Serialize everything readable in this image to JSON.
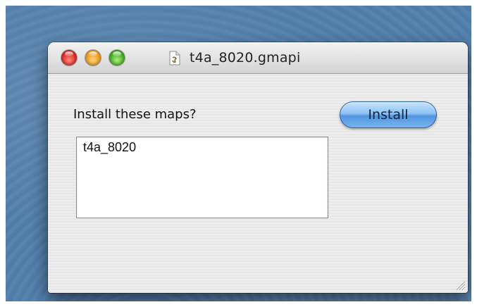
{
  "window": {
    "title": "t4a_8020.gmapi",
    "document_icon": "document-icon"
  },
  "dialog": {
    "prompt": "Install these maps?",
    "install_label": "Install",
    "maps": [
      "t4a_8020"
    ]
  },
  "colors": {
    "desktop": "#5680ad",
    "close": "#d6261c",
    "minimize": "#e8961b",
    "zoom": "#3ea81e",
    "install_button": "#6aaaf0"
  }
}
